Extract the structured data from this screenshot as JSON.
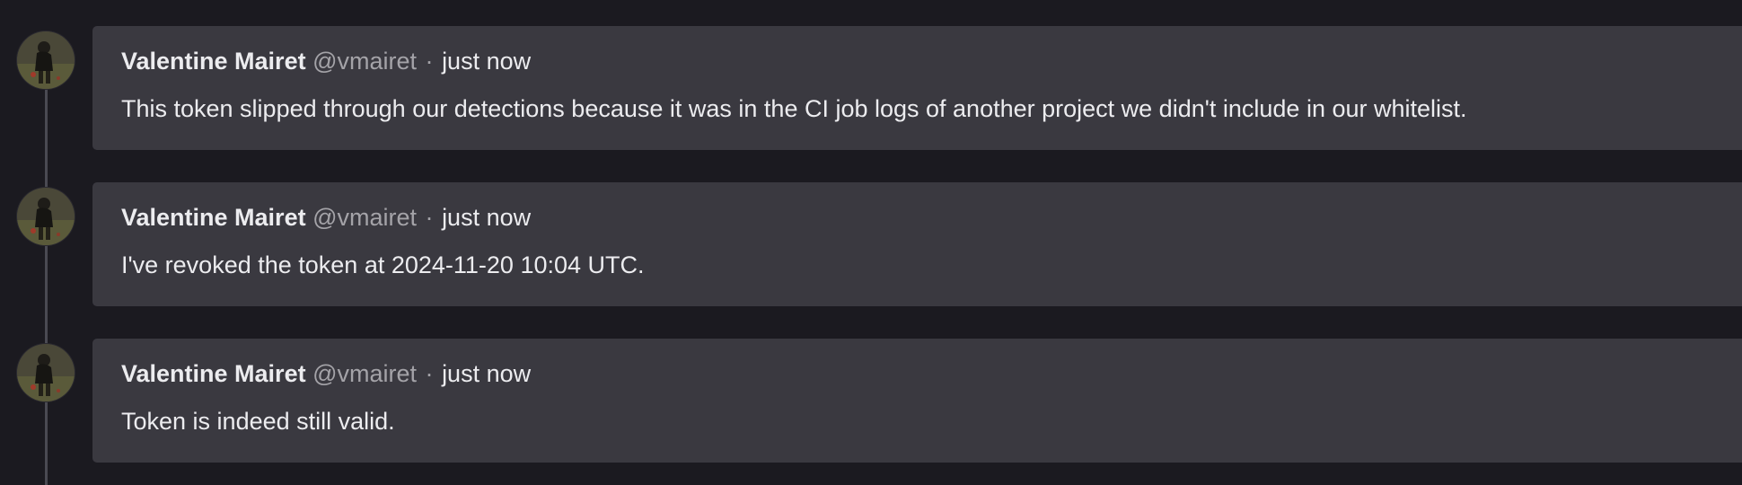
{
  "notes": [
    {
      "author": "Valentine Mairet",
      "username": "@vmairet",
      "separator": "·",
      "time": "just now",
      "body": "This token slipped through our detections because it was in the CI job logs of another project we didn't include in our whitelist.",
      "avatar_icon": "user-avatar"
    },
    {
      "author": "Valentine Mairet",
      "username": "@vmairet",
      "separator": "·",
      "time": "just now",
      "body": "I've revoked the token at 2024-11-20 10:04 UTC.",
      "avatar_icon": "user-avatar"
    },
    {
      "author": "Valentine Mairet",
      "username": "@vmairet",
      "separator": "·",
      "time": "just now",
      "body": "Token is indeed still valid.",
      "avatar_icon": "user-avatar"
    }
  ],
  "colors": {
    "background": "#1b1a20",
    "card": "#3a3940",
    "text": "#ececef",
    "muted": "#a4a3a8",
    "timeline": "#4a4a52"
  }
}
